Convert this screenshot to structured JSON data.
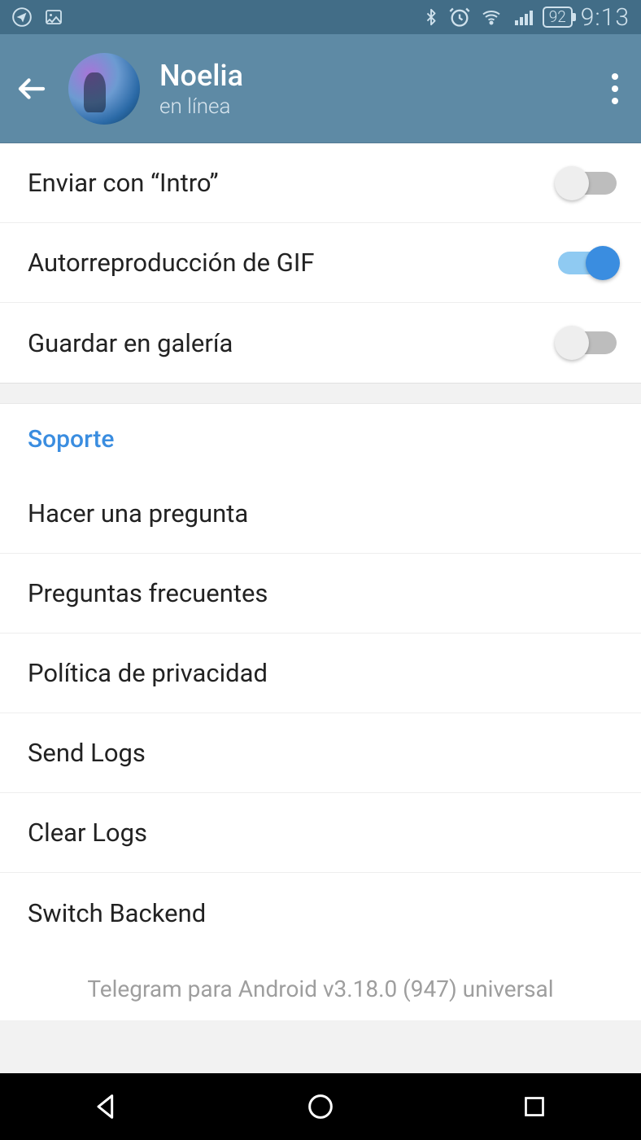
{
  "status_bar": {
    "battery": "92",
    "time": "9:13",
    "icons": {
      "telegram": "telegram-icon",
      "image": "image-icon",
      "bluetooth": "bluetooth-icon",
      "alarm": "alarm-icon",
      "wifi": "wifi-icon",
      "signal": "signal-icon"
    }
  },
  "header": {
    "name": "Noelia",
    "status": "en línea"
  },
  "toggles": [
    {
      "label": "Enviar con “Intro”",
      "value": false
    },
    {
      "label": "Autorreproducción de GIF",
      "value": true
    },
    {
      "label": "Guardar en galería",
      "value": false
    }
  ],
  "support": {
    "title": "Soporte",
    "items": [
      "Hacer una pregunta",
      "Preguntas frecuentes",
      "Política de privacidad",
      "Send Logs",
      "Clear Logs",
      "Switch Backend"
    ]
  },
  "footer": {
    "version": "Telegram para Android v3.18.0 (947) universal"
  },
  "colors": {
    "primary": "#5e8aa5",
    "status_bg": "#426d87",
    "accent": "#3a8de0"
  }
}
